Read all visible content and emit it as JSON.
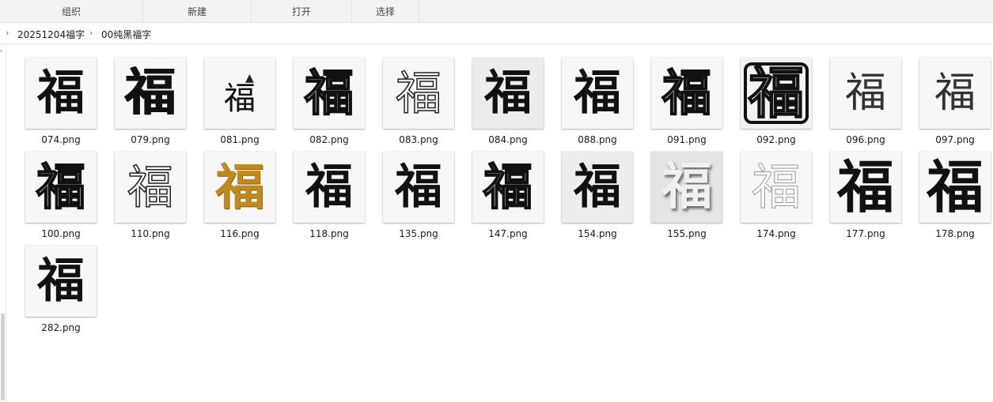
{
  "toolbar": {
    "groups": [
      "组织",
      "新建",
      "打开",
      "选择"
    ]
  },
  "breadcrumb": {
    "items": [
      "20251204福字",
      "00纯黑福字"
    ]
  },
  "glyph_char": "福",
  "files": [
    {
      "name": "074.png",
      "style": "normal"
    },
    {
      "name": "079.png",
      "style": "heavy"
    },
    {
      "name": "081.png",
      "style": "bird"
    },
    {
      "name": "082.png",
      "style": "outline"
    },
    {
      "name": "083.png",
      "style": "outline-thin"
    },
    {
      "name": "084.png",
      "style": "shadow"
    },
    {
      "name": "088.png",
      "style": "normal"
    },
    {
      "name": "091.png",
      "style": "outline"
    },
    {
      "name": "092.png",
      "style": "seal"
    },
    {
      "name": "096.png",
      "style": "thin"
    },
    {
      "name": "097.png",
      "style": "thin"
    },
    {
      "name": "100.png",
      "style": "outline"
    },
    {
      "name": "110.png",
      "style": "outline-thin"
    },
    {
      "name": "116.png",
      "style": "gold"
    },
    {
      "name": "118.png",
      "style": "normal"
    },
    {
      "name": "135.png",
      "style": "normal"
    },
    {
      "name": "147.png",
      "style": "outline"
    },
    {
      "name": "154.png",
      "style": "grey"
    },
    {
      "name": "155.png",
      "style": "emboss"
    },
    {
      "name": "174.png",
      "style": "outline-light"
    },
    {
      "name": "177.png",
      "style": "big"
    },
    {
      "name": "178.png",
      "style": "big"
    },
    {
      "name": "282.png",
      "style": "normal"
    }
  ]
}
